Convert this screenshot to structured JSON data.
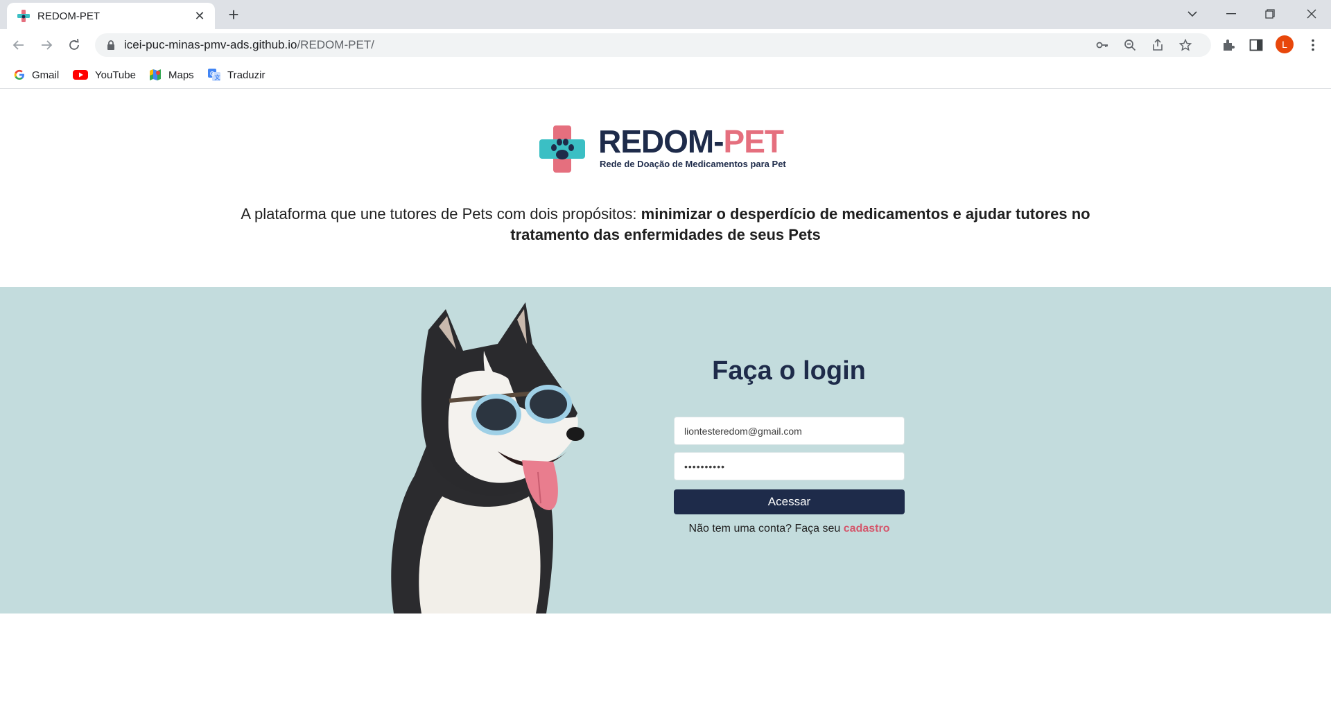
{
  "browser": {
    "tab_title": "REDOM-PET",
    "url_host": "icei-puc-minas-pmv-ads.github.io",
    "url_path": "/REDOM-PET/",
    "avatar_initial": "L",
    "bookmarks": [
      {
        "label": "Gmail",
        "icon": "gmail-icon"
      },
      {
        "label": "YouTube",
        "icon": "youtube-icon"
      },
      {
        "label": "Maps",
        "icon": "maps-icon"
      },
      {
        "label": "Traduzir",
        "icon": "translate-icon"
      }
    ]
  },
  "logo": {
    "title_part1": "REDOM-",
    "title_part2": "PET",
    "subtitle": "Rede de Doação de Medicamentos para Pet",
    "colors": {
      "navy": "#1e2b4a",
      "pink": "#e56f7e",
      "teal": "#3bbfc4"
    }
  },
  "tagline": {
    "normal": "A plataforma que une tutores de Pets com dois propósitos: ",
    "bold": "minimizar o desperdício de medicamentos e ajudar tutores no tratamento das enfermidades de seus Pets"
  },
  "login": {
    "title": "Faça o login",
    "email_value": "liontesteredom@gmail.com",
    "password_value": "••••••••••",
    "submit_label": "Acessar",
    "signup_prompt": "Não tem uma conta? Faça seu ",
    "signup_link": "cadastro"
  },
  "colors": {
    "hero_background": "#c3dcdd",
    "button": "#1e2b4a",
    "link": "#d4576c"
  }
}
